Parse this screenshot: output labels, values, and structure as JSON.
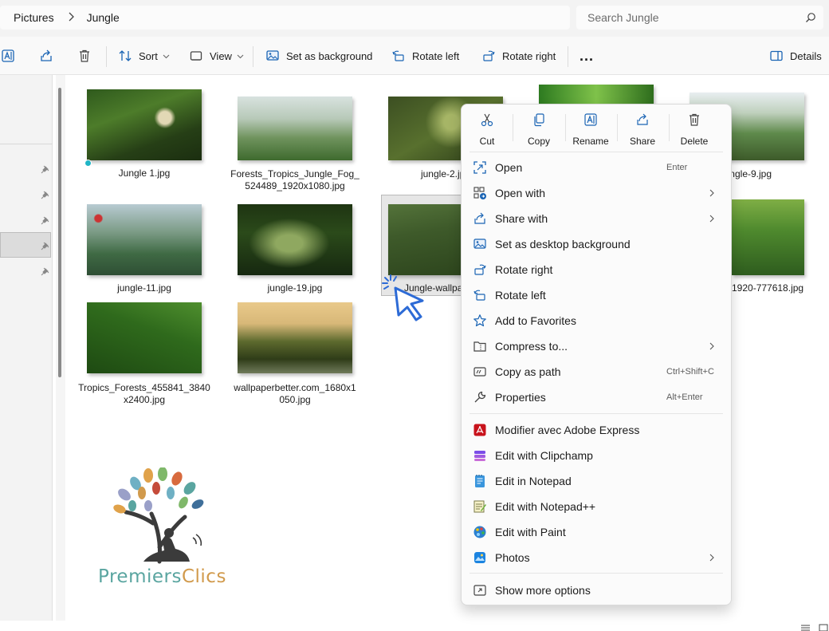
{
  "address": {
    "crumbs": [
      "Pictures",
      "Jungle"
    ]
  },
  "search": {
    "placeholder": "Search Jungle"
  },
  "toolbar": {
    "sort": "Sort",
    "view": "View",
    "set_background": "Set as background",
    "rotate_left": "Rotate left",
    "rotate_right": "Rotate right",
    "more": "...",
    "details": "Details"
  },
  "files": [
    {
      "name": "Jungle 1.jpg"
    },
    {
      "name": "Forests_Tropics_Jungle_Fog_",
      "name2": "524489_1920x1080.jpg"
    },
    {
      "name": "jungle-2.jpg"
    },
    {
      "name": "jungle-9.jpg"
    },
    {
      "name": "jungle-11.jpg"
    },
    {
      "name": "jungle-19.jpg"
    },
    {
      "name": "Jungle-wallpaper.jpg"
    },
    {
      "name": "1920-777618.jpg"
    },
    {
      "name": "Tropics_Forests_455841_3840",
      "name2": "x2400.jpg"
    },
    {
      "name": "wallpaperbetter.com_1680x1",
      "name2": "050.jpg"
    }
  ],
  "context_menu": {
    "quick_actions": [
      {
        "label": "Cut",
        "icon": "cut-icon"
      },
      {
        "label": "Copy",
        "icon": "copy-icon"
      },
      {
        "label": "Rename",
        "icon": "rename-icon"
      },
      {
        "label": "Share",
        "icon": "share-icon"
      },
      {
        "label": "Delete",
        "icon": "delete-icon"
      }
    ],
    "items": [
      {
        "label": "Open",
        "shortcut": "Enter",
        "icon": "open-icon"
      },
      {
        "label": "Open with",
        "icon": "open-with-icon"
      },
      {
        "label": "Share with",
        "icon": "share-with-icon"
      },
      {
        "label": "Set as desktop background",
        "icon": "desktop-background-icon"
      },
      {
        "label": "Rotate right",
        "icon": "rotate-right-icon"
      },
      {
        "label": "Rotate left",
        "icon": "rotate-left-icon"
      },
      {
        "label": "Add to Favorites",
        "icon": "star-icon"
      },
      {
        "label": "Compress to...",
        "icon": "zip-folder-icon"
      },
      {
        "label": "Copy as path",
        "shortcut": "Ctrl+Shift+C",
        "icon": "copy-path-icon"
      },
      {
        "label": "Properties",
        "shortcut": "Alt+Enter",
        "icon": "wrench-icon"
      }
    ],
    "apps": [
      {
        "label": "Modifier avec Adobe Express",
        "icon": "adobe-acrobat-icon"
      },
      {
        "label": "Edit with Clipchamp",
        "icon": "clipchamp-icon"
      },
      {
        "label": "Edit in Notepad",
        "icon": "notepad-icon"
      },
      {
        "label": "Edit with Notepad++",
        "icon": "notepad-plus-plus-icon"
      },
      {
        "label": "Edit with Paint",
        "icon": "paint-icon"
      },
      {
        "label": "Photos",
        "icon": "photos-icon"
      }
    ],
    "more": {
      "label": "Show more options",
      "icon": "show-more-options-icon"
    }
  },
  "logo": {
    "part1": "Premiers",
    "part2": "Clics"
  },
  "colors": {
    "accent": "#0067c0",
    "menu_bg": "#fbfbfb",
    "logo_teal": "#5aa5a0",
    "logo_gold": "#d19a4c"
  }
}
